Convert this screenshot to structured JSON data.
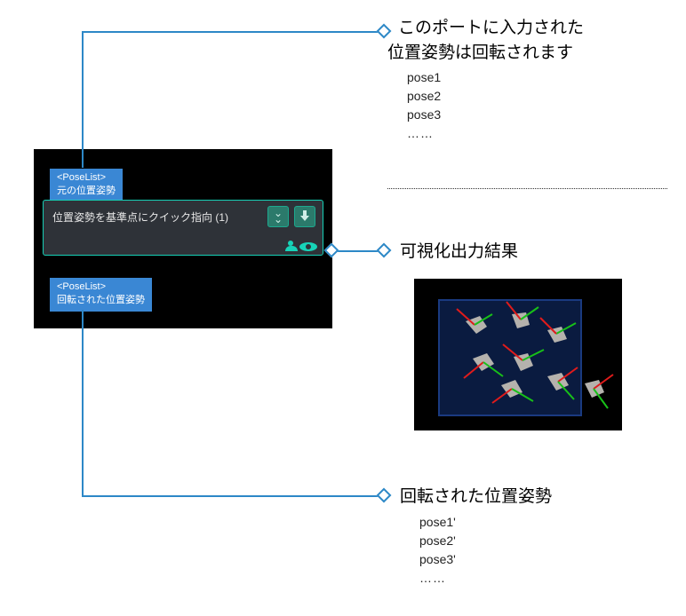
{
  "callouts": {
    "input": {
      "title_line1": "このポートに入力された",
      "title_line2": "位置姿勢は回転されます",
      "items": [
        "pose1",
        "pose2",
        "pose3",
        "……"
      ]
    },
    "viz": {
      "title": "可視化出力結果"
    },
    "output": {
      "title": "回転された位置姿勢",
      "items": [
        "pose1'",
        "pose2'",
        "pose3'",
        "……"
      ]
    }
  },
  "node": {
    "input_port": {
      "type": "<PoseList>",
      "label": "元の位置姿勢"
    },
    "output_port": {
      "type": "<PoseList>",
      "label": "回転された位置姿勢"
    },
    "title": "位置姿勢を基準点にクイック指向 (1)"
  },
  "icons": {
    "expand": "expand-icon",
    "download": "arrow-down-icon",
    "viewer": "eye-icon"
  },
  "colors": {
    "connector": "#2d88c7",
    "port_chip": "#3a87d4",
    "node_border": "#16d0b6",
    "node_bg": "#2e3238"
  }
}
